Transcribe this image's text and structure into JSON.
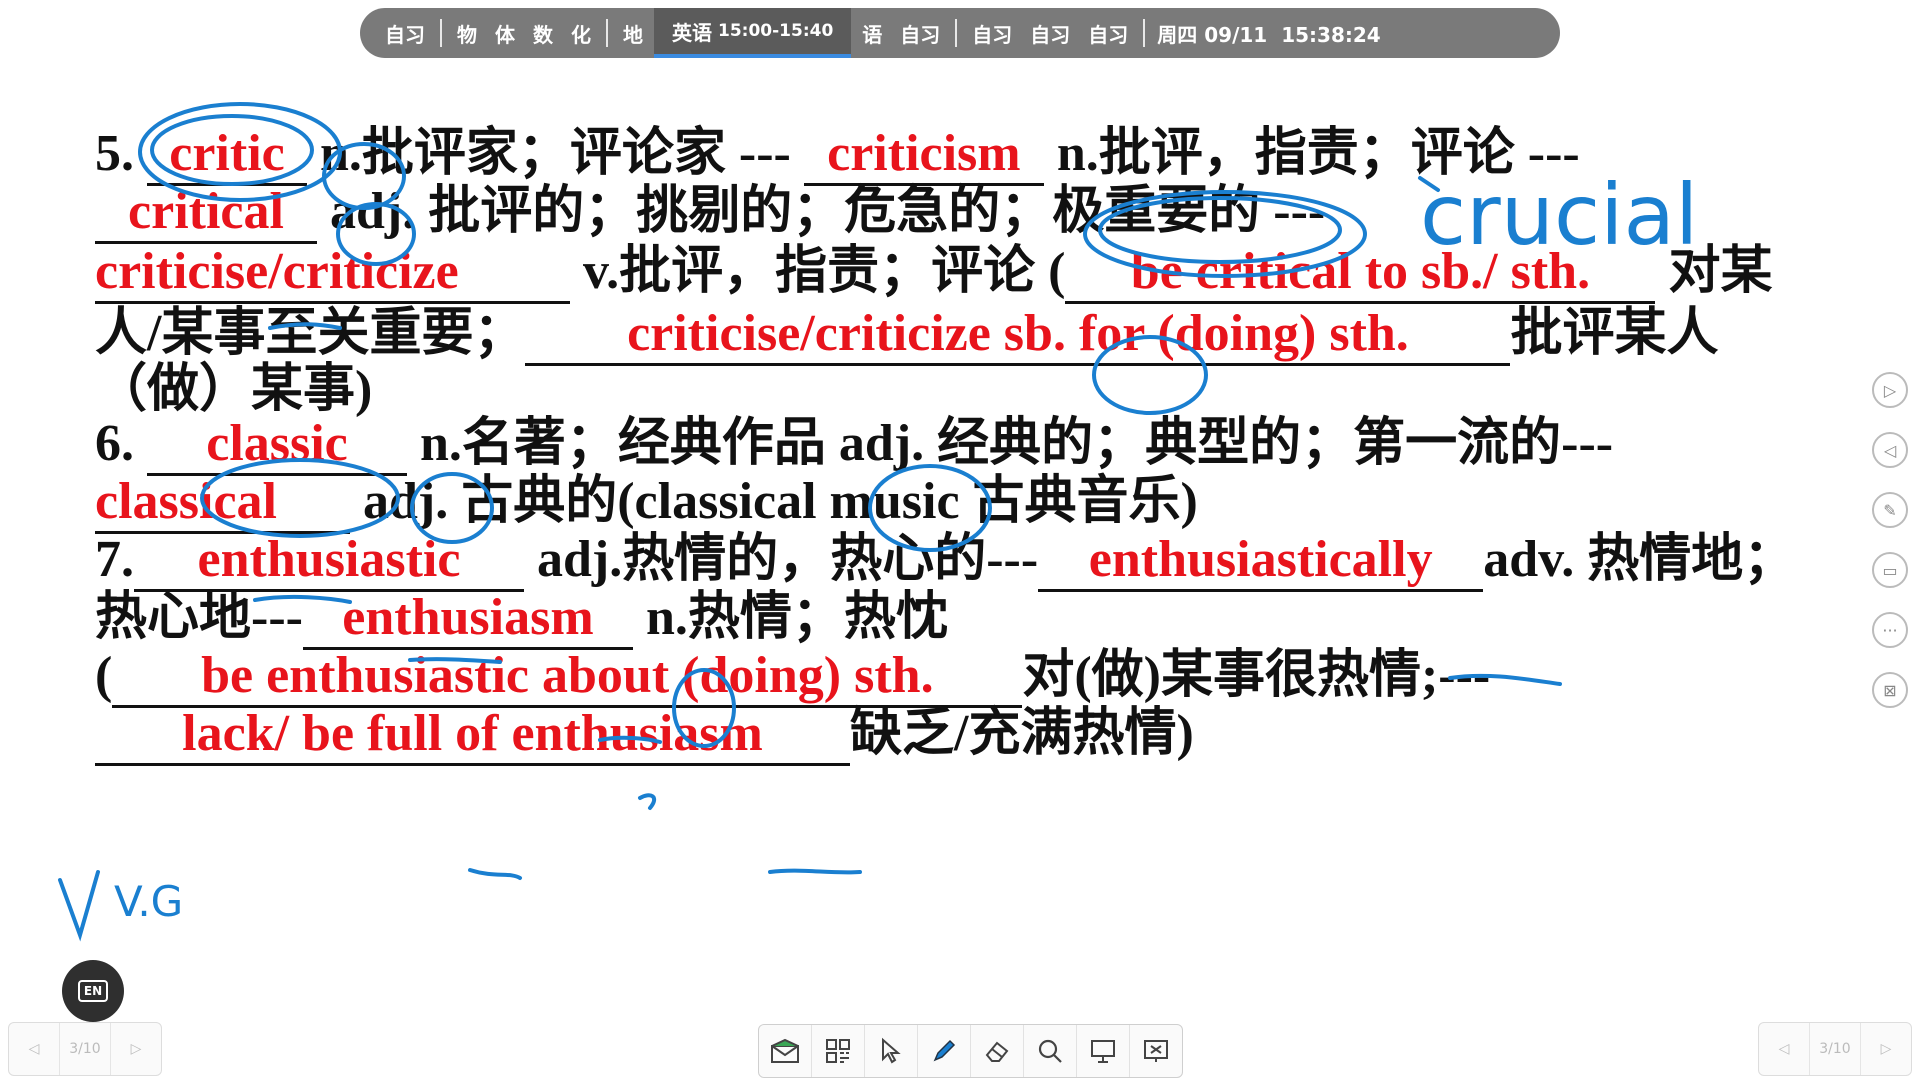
{
  "topbar": {
    "periods": [
      "自习",
      "物",
      "体",
      "数",
      "化",
      "地"
    ],
    "current": {
      "subject": "英语",
      "time": "15:00-15:40"
    },
    "after": [
      "语",
      "自习",
      "自习",
      "自习",
      "自习"
    ],
    "date": "周四 09/11",
    "time": "15:38:24"
  },
  "slide": {
    "l1": {
      "num": "5.",
      "a1": "critic",
      "t1": "n.批评家；评论家 ---",
      "a2": "criticism",
      "t2": "n.批评，指责；评论 ---"
    },
    "l2": {
      "a1": "critical",
      "t1": "adj. 批评的；挑剔的；危急的；",
      "t2": "极重要的",
      "t3": " ---"
    },
    "l3": {
      "a1": "criticise/criticize",
      "t1": "v.批评，指责；评论 (",
      "a2": "be critical to sb./ sth.",
      "t2": " 对某"
    },
    "l4": {
      "t1": "人/某事至关重要；",
      "a1": "criticise/criticize sb. for (doing) sth.",
      "t2": "批评某人"
    },
    "l5": {
      "t1": "（做）某事)"
    },
    "l6": {
      "num": "6. ",
      "a1": "classic",
      "t1": " n.名著；经典作品 adj. 经典的；典型的；第一流的---"
    },
    "l7": {
      "a1": "classical",
      "t1": " adj. 古典的(classical music 古典音乐)"
    },
    "l8": {
      "num": "7.",
      "a1": "enthusiastic",
      "t1": " adj.热情的，热心的---",
      "a2": "enthusiastically",
      "t2": "adv. 热情地；"
    },
    "l9": {
      "t1": "热心地---",
      "a1": "enthusiasm",
      "t2": " n.热情；热忱"
    },
    "l10": {
      "t1": "(",
      "a1": "be enthusiastic about (doing) sth.",
      "t2": "对(做)某事很热情;---"
    },
    "l11": {
      "a1": "lack/ be full of enthusiasm",
      "t1": "缺乏/充满热情)"
    }
  },
  "handwriting": {
    "crucial": "crucial",
    "note": "V.G"
  },
  "pager": {
    "left": "3/10",
    "right": "3/10"
  },
  "lang_button": "EN",
  "colors": {
    "answer": "#e8141c",
    "ink": "#1a7fd0",
    "topbar": "#7a7a7a"
  }
}
